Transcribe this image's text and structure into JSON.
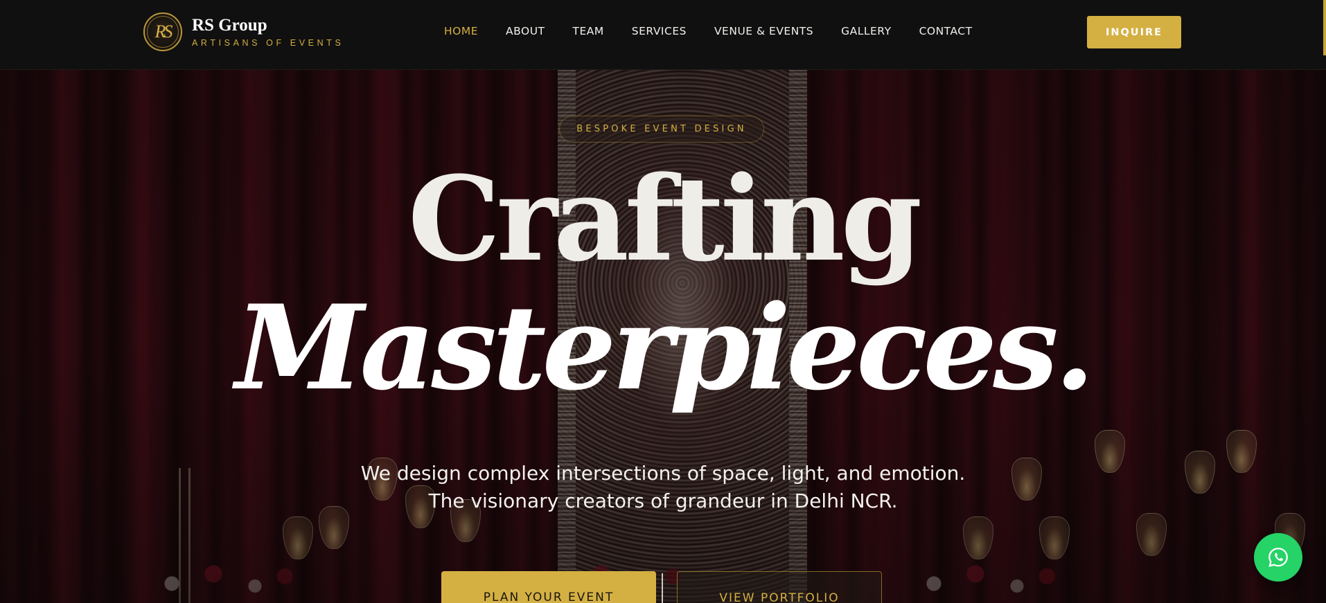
{
  "brand": {
    "monogram": "RS",
    "name": "RS Group",
    "tagline": "ARTISANS OF EVENTS"
  },
  "nav": {
    "items": [
      {
        "label": "HOME",
        "active": true
      },
      {
        "label": "ABOUT",
        "active": false
      },
      {
        "label": "TEAM",
        "active": false
      },
      {
        "label": "SERVICES",
        "active": false
      },
      {
        "label": "VENUE & EVENTS",
        "active": false
      },
      {
        "label": "GALLERY",
        "active": false
      },
      {
        "label": "CONTACT",
        "active": false
      }
    ],
    "inquire_label": "INQUIRE"
  },
  "hero": {
    "badge": "BESPOKE EVENT DESIGN",
    "headline_line1": "Crafting",
    "headline_line2": "Masterpieces.",
    "subtitle": "We design complex intersections of space, light, and emotion. The visionary creators of grandeur in Delhi NCR.",
    "cta_primary": "PLAN YOUR EVENT",
    "cta_secondary": "VIEW PORTFOLIO"
  },
  "floating": {
    "whatsapp_icon": "whatsapp-icon"
  },
  "colors": {
    "accent_gold": "#d4b043",
    "header_bg": "#111010",
    "whatsapp_green": "#25d366"
  }
}
